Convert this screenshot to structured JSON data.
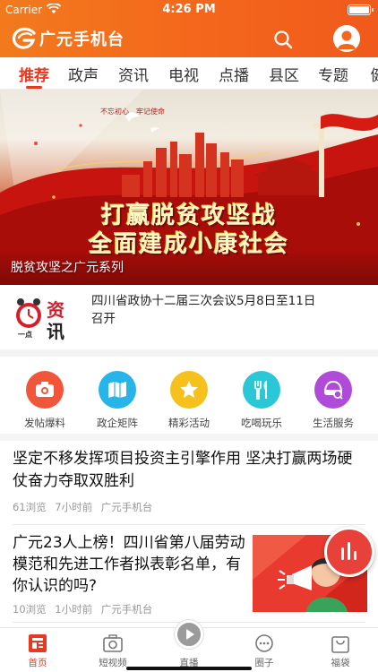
{
  "status_bar": {
    "carrier": "Carrier",
    "time": "4:26 PM"
  },
  "header": {
    "app_name": "广元手机台"
  },
  "tabs": [
    {
      "label": "推荐",
      "active": true
    },
    {
      "label": "政声"
    },
    {
      "label": "资讯"
    },
    {
      "label": "电视"
    },
    {
      "label": "点播"
    },
    {
      "label": "县区"
    },
    {
      "label": "专题"
    },
    {
      "label": "健"
    }
  ],
  "banner": {
    "slogan_line1": "打赢脱贫攻坚战",
    "slogan_line2": "全面建成小康社会",
    "small_text": "不忘初心　牢记使命",
    "caption": "脱贫攻坚之广元系列"
  },
  "news_flash": {
    "logo_top": "资",
    "logo_bottom": "讯",
    "logo_clock_label": "一点",
    "text": "四川省政协十二届三次会议5月8日至11日召开"
  },
  "quick_actions": [
    {
      "label": "发帖爆料",
      "icon": "camera-icon",
      "color": "#f2563a"
    },
    {
      "label": "政企矩阵",
      "icon": "book-icon",
      "color": "#27b4e8"
    },
    {
      "label": "精彩活动",
      "icon": "star-icon",
      "color": "#f6c11c"
    },
    {
      "label": "吃喝玩乐",
      "icon": "cutlery-icon",
      "color": "#2cc7d6"
    },
    {
      "label": "生活服务",
      "icon": "service-icon",
      "color": "#b04ad8"
    }
  ],
  "articles": [
    {
      "title": "坚定不移发挥项目投资主引擎作用 坚决打赢两场硬仗奋力夺取双胜利",
      "views": "61浏览",
      "time": "7小时前",
      "source": "广元手机台"
    },
    {
      "title": "广元23人上榜！四川省第八届劳动模范和先进工作者拟表彰名单，有你认识的吗?",
      "views": "10浏览",
      "time": "1小时前",
      "source": "广元手机台"
    }
  ],
  "bottom_nav": [
    {
      "label": "首页",
      "icon": "home-icon",
      "active": true
    },
    {
      "label": "短视频",
      "icon": "camera-icon"
    },
    {
      "label": "直播",
      "icon": "play-icon"
    },
    {
      "label": "圈子",
      "icon": "chat-icon"
    },
    {
      "label": "福袋",
      "icon": "bag-icon"
    }
  ],
  "colors": {
    "brand": "#f4661c",
    "accent_red": "#e8381f"
  }
}
